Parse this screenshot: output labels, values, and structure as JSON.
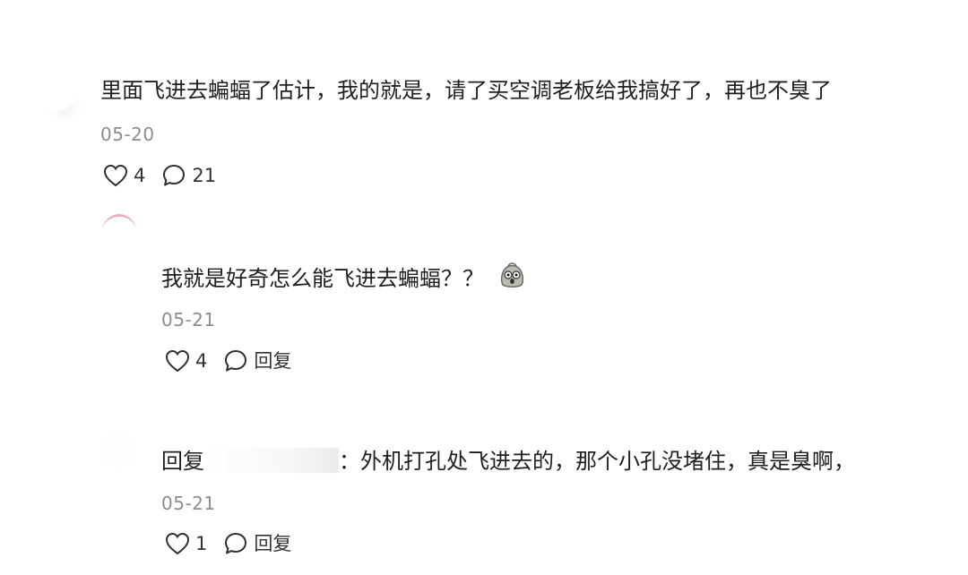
{
  "comments": [
    {
      "text": "里面飞进去蝙蝠了估计，我的就是，请了买空调老板给我搞好了，再也不臭了",
      "date": "05-20",
      "likes": "4",
      "replies": "21"
    },
    {
      "text": "我就是好奇怎么能飞进去蝙蝠？？",
      "emoji": "surprised-face-emoji",
      "date": "05-21",
      "likes": "4",
      "reply_label": "回复"
    },
    {
      "prefix": "回复",
      "text": "：外机打孔处飞进去的，那个小孔没堵住，真是臭啊，",
      "date": "05-21",
      "likes": "1",
      "reply_label": "回复"
    }
  ],
  "icons": {
    "like": "heart-outline-icon",
    "comment": "speech-bubble-icon"
  },
  "colors": {
    "text": "#1f1f1f",
    "secondary_text": "#8d8d8d",
    "icon": "#2f2f2f"
  }
}
